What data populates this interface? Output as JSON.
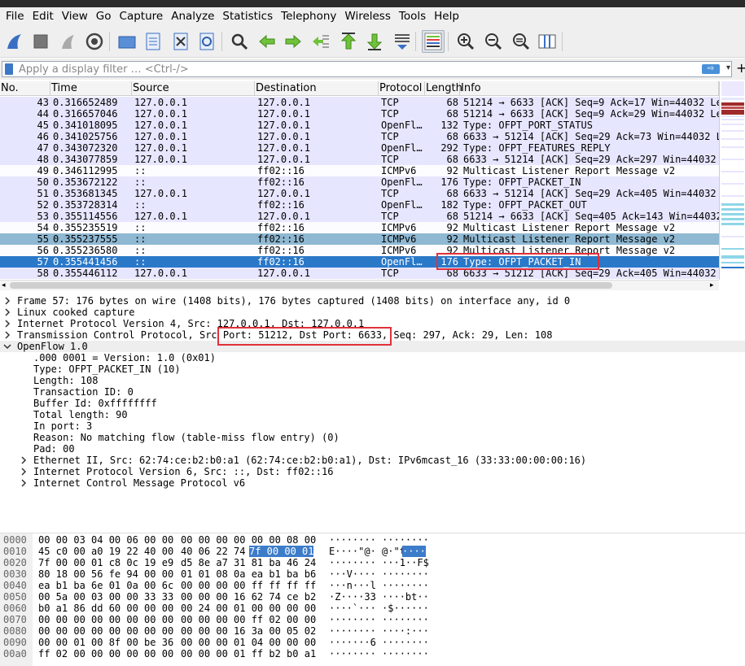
{
  "menubar": {
    "items": [
      "File",
      "Edit",
      "View",
      "Go",
      "Capture",
      "Analyze",
      "Statistics",
      "Telephony",
      "Wireless",
      "Tools",
      "Help"
    ]
  },
  "toolbar": {
    "icons": [
      "shark-fin-start-icon",
      "stop-square-icon",
      "restart-fin-icon",
      "gear-options-icon",
      "folder-open-icon",
      "file-save-icon",
      "file-close-icon",
      "reload-icon",
      "find-magnifier-icon",
      "arrow-back-icon",
      "arrow-forward-icon",
      "go-to-packet-icon",
      "first-packet-icon",
      "last-packet-icon",
      "autoscroll-icon",
      "colorize-icon",
      "zoom-in-icon",
      "zoom-out-icon",
      "zoom-normal-icon",
      "resize-columns-icon"
    ]
  },
  "filter": {
    "placeholder": "Apply a display filter … <Ctrl-/>",
    "apply_arrow": "⇨",
    "dropdown": "▾",
    "add": "+"
  },
  "packet_list": {
    "columns": [
      "No.",
      "Time",
      "Source",
      "Destination",
      "Protocol",
      "Length",
      "Info"
    ],
    "rows": [
      {
        "no": "43",
        "time": "0.316652489",
        "src": "127.0.0.1",
        "dst": "127.0.0.1",
        "proto": "TCP",
        "len": "68",
        "info": "51214 → 6633 [ACK] Seq=9 Ack=17 Win=44032 Le",
        "bg": "#e7e6ff"
      },
      {
        "no": "44",
        "time": "0.316657046",
        "src": "127.0.0.1",
        "dst": "127.0.0.1",
        "proto": "TCP",
        "len": "68",
        "info": "51214 → 6633 [ACK] Seq=9 Ack=29 Win=44032 Le",
        "bg": "#e7e6ff"
      },
      {
        "no": "45",
        "time": "0.341018095",
        "src": "127.0.0.1",
        "dst": "127.0.0.1",
        "proto": "OpenFl…",
        "len": "132",
        "info": "Type: OFPT_PORT_STATUS",
        "bg": "#e7e6ff"
      },
      {
        "no": "46",
        "time": "0.341025756",
        "src": "127.0.0.1",
        "dst": "127.0.0.1",
        "proto": "TCP",
        "len": "68",
        "info": "6633 → 51214 [ACK] Seq=29 Ack=73 Win=44032 L",
        "bg": "#e7e6ff"
      },
      {
        "no": "47",
        "time": "0.343072320",
        "src": "127.0.0.1",
        "dst": "127.0.0.1",
        "proto": "OpenFl…",
        "len": "292",
        "info": "Type: OFPT_FEATURES_REPLY",
        "bg": "#e7e6ff"
      },
      {
        "no": "48",
        "time": "0.343077859",
        "src": "127.0.0.1",
        "dst": "127.0.0.1",
        "proto": "TCP",
        "len": "68",
        "info": "6633 → 51214 [ACK] Seq=29 Ack=297 Win=44032",
        "bg": "#e7e6ff"
      },
      {
        "no": "49",
        "time": "0.346112995",
        "src": "::",
        "dst": "ff02::16",
        "proto": "ICMPv6",
        "len": "92",
        "info": "Multicast Listener Report Message v2",
        "bg": "#fcfcff"
      },
      {
        "no": "50",
        "time": "0.353672122",
        "src": "::",
        "dst": "ff02::16",
        "proto": "OpenFl…",
        "len": "176",
        "info": "Type: OFPT_PACKET_IN",
        "bg": "#e7e6ff"
      },
      {
        "no": "51",
        "time": "0.353681345",
        "src": "127.0.0.1",
        "dst": "127.0.0.1",
        "proto": "TCP",
        "len": "68",
        "info": "6633 → 51214 [ACK] Seq=29 Ack=405 Win=44032",
        "bg": "#e7e6ff"
      },
      {
        "no": "52",
        "time": "0.353728314",
        "src": "::",
        "dst": "ff02::16",
        "proto": "OpenFl…",
        "len": "182",
        "info": "Type: OFPT_PACKET_OUT",
        "bg": "#e7e6ff"
      },
      {
        "no": "53",
        "time": "0.355114556",
        "src": "127.0.0.1",
        "dst": "127.0.0.1",
        "proto": "TCP",
        "len": "68",
        "info": "51214 → 6633 [ACK] Seq=405 Ack=143 Win=44032",
        "bg": "#e7e6ff"
      },
      {
        "no": "54",
        "time": "0.355235519",
        "src": "::",
        "dst": "ff02::16",
        "proto": "ICMPv6",
        "len": "92",
        "info": "Multicast Listener Report Message v2",
        "bg": "#fcfcff"
      },
      {
        "no": "55",
        "time": "0.355237555",
        "src": "::",
        "dst": "ff02::16",
        "proto": "ICMPv6",
        "len": "92",
        "info": "Multicast Listener Report Message v2",
        "bg": "#8fb8d2"
      },
      {
        "no": "56",
        "time": "0.355236580",
        "src": "::",
        "dst": "ff02::16",
        "proto": "ICMPv6",
        "len": "92",
        "info": "Multicast Listener Report Message v2",
        "bg": "#fcfcff"
      },
      {
        "no": "57",
        "time": "0.355441456",
        "src": "::",
        "dst": "ff02::16",
        "proto": "OpenFl…",
        "len": "176",
        "info": "Type: OFPT_PACKET_IN",
        "bg": "#2a78c8",
        "selected": true
      },
      {
        "no": "58",
        "time": "0.355446112",
        "src": "127.0.0.1",
        "dst": "127.0.0.1",
        "proto": "TCP",
        "len": "68",
        "info": "6633 → 51212 [ACK] Seq=29 Ack=405 Win=44032",
        "bg": "#e7e6ff"
      }
    ]
  },
  "details": {
    "rows": [
      {
        "indent": 0,
        "arrow": "right",
        "text": "Frame 57: 176 bytes on wire (1408 bits), 176 bytes captured (1408 bits) on interface any, id 0"
      },
      {
        "indent": 0,
        "arrow": "right",
        "text": "Linux cooked capture"
      },
      {
        "indent": 0,
        "arrow": "right",
        "text": "Internet Protocol Version 4, Src: 127.0.0.1, Dst: 127.0.0.1"
      },
      {
        "indent": 0,
        "arrow": "right",
        "text": "Transmission Control Protocol, Src Port: 51212, Dst Port: 6633, Seq: 297, Ack: 29, Len: 108"
      },
      {
        "indent": 0,
        "arrow": "down",
        "text": "OpenFlow 1.0"
      },
      {
        "indent": 1,
        "arrow": "",
        "text": ".000 0001 = Version: 1.0 (0x01)"
      },
      {
        "indent": 1,
        "arrow": "",
        "text": "Type: OFPT_PACKET_IN (10)"
      },
      {
        "indent": 1,
        "arrow": "",
        "text": "Length: 108"
      },
      {
        "indent": 1,
        "arrow": "",
        "text": "Transaction ID: 0"
      },
      {
        "indent": 1,
        "arrow": "",
        "text": "Buffer Id: 0xffffffff"
      },
      {
        "indent": 1,
        "arrow": "",
        "text": "Total length: 90"
      },
      {
        "indent": 1,
        "arrow": "",
        "text": "In port: 3"
      },
      {
        "indent": 1,
        "arrow": "",
        "text": "Reason: No matching flow (table-miss flow entry) (0)"
      },
      {
        "indent": 1,
        "arrow": "",
        "text": "Pad: 00"
      },
      {
        "indent": 1,
        "arrow": "right",
        "text": "Ethernet II, Src: 62:74:ce:b2:b0:a1 (62:74:ce:b2:b0:a1), Dst: IPv6mcast_16 (33:33:00:00:00:16)"
      },
      {
        "indent": 1,
        "arrow": "right",
        "text": "Internet Protocol Version 6, Src: ::, Dst: ff02::16"
      },
      {
        "indent": 1,
        "arrow": "right",
        "text": "Internet Control Message Protocol v6"
      }
    ]
  },
  "hex": {
    "rows": [
      {
        "off": "0000",
        "a": "00 00 03 04 00 06 00 00",
        "b": "00 00 00 00 00 00 08 00",
        "ascii": "········ ········"
      },
      {
        "off": "0010",
        "a": "45 c0 00 a0 19 22 40 00",
        "b": "40 06 22 74",
        "bh": "7f 00 00 01",
        "ascii": "E····\"@· @·\"t",
        "asciih": "····"
      },
      {
        "off": "0020",
        "a": "7f 00 00 01 c8 0c 19 e9",
        "b": "d5 8e a7 31 81 ba 46 24",
        "ascii": "········ ···1··F$"
      },
      {
        "off": "0030",
        "a": "80 18 00 56 fe 94 00 00",
        "b": "01 01 08 0a ea b1 ba b6",
        "ascii": "···V···· ········"
      },
      {
        "off": "0040",
        "a": "ea b1 ba 6e 01 0a 00 6c",
        "b": "00 00 00 00 ff ff ff ff",
        "ascii": "···n···l ········"
      },
      {
        "off": "0050",
        "a": "00 5a 00 03 00 00 33 33",
        "b": "00 00 00 16 62 74 ce b2",
        "ascii": "·Z····33 ····bt··"
      },
      {
        "off": "0060",
        "a": "b0 a1 86 dd 60 00 00 00",
        "b": "00 24 00 01 00 00 00 00",
        "ascii": "····`··· ·$······"
      },
      {
        "off": "0070",
        "a": "00 00 00 00 00 00 00 00",
        "b": "00 00 00 00 ff 02 00 00",
        "ascii": "········ ········"
      },
      {
        "off": "0080",
        "a": "00 00 00 00 00 00 00 00",
        "b": "00 00 00 16 3a 00 05 02",
        "ascii": "········ ····:···"
      },
      {
        "off": "0090",
        "a": "00 00 01 00 8f 00 be 36",
        "b": "00 00 00 01 04 00 00 00",
        "ascii": "·······6 ········"
      },
      {
        "off": "00a0",
        "a": "ff 02 00 00 00 00 00 00",
        "b": "00 00 00 01 ff b2 b0 a1",
        "ascii": "········ ········"
      }
    ]
  }
}
